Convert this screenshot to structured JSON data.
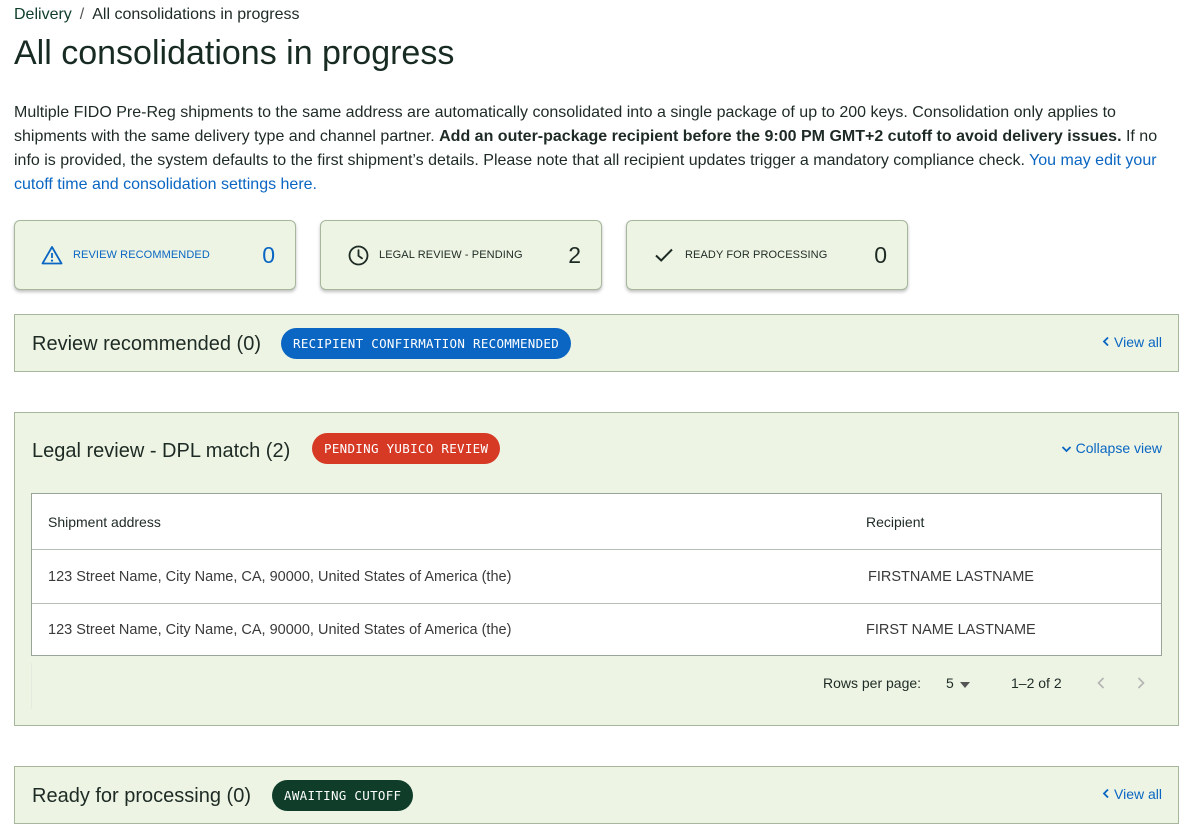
{
  "breadcrumb": {
    "parent": "Delivery",
    "separator": "/",
    "current": "All consolidations in progress"
  },
  "page_title": "All consolidations in progress",
  "intro": {
    "text1": "Multiple FIDO Pre-Reg shipments to the same address are automatically consolidated into a single package of up to 200 keys. Consolidation only applies to shipments with the same delivery type and channel partner. ",
    "bold": "Add an outer-package recipient before the 9:00 PM GMT+2 cutoff to avoid delivery issues.",
    "text2": " If no info is provided, the system defaults to the first shipment’s details. Please note that all recipient updates trigger a mandatory compliance check. ",
    "link": "You may edit your cutoff time and consolidation settings here."
  },
  "status_cards": {
    "review": {
      "icon": "warning-triangle-icon",
      "label": "REVIEW RECOMMENDED",
      "count": "0"
    },
    "legal": {
      "icon": "clock-icon",
      "label": "LEGAL REVIEW - PENDING",
      "count": "2"
    },
    "ready": {
      "icon": "checkmark-icon",
      "label": "READY FOR PROCESSING",
      "count": "0"
    }
  },
  "sections": {
    "review": {
      "title": "Review recommended (0)",
      "pill": "RECIPIENT CONFIRMATION RECOMMENDED",
      "action": "View all"
    },
    "legal": {
      "title": "Legal review - DPL match (2)",
      "pill": "PENDING YUBICO REVIEW",
      "action": "Collapse view"
    },
    "ready": {
      "title": "Ready for processing (0)",
      "pill": "AWAITING CUTOFF",
      "action": "View all"
    }
  },
  "table": {
    "headers": [
      "Shipment address",
      "Recipient"
    ],
    "rows": [
      [
        "123 Street Name, City Name, CA, 90000, United States of America (the)",
        "FIRSTNAME LASTNAME"
      ],
      [
        "123 Street Name, City Name, CA, 90000, United States of America (the)",
        "FIRST NAME LASTNAME"
      ]
    ]
  },
  "pagination": {
    "rows_per_page_label": "Rows per page:",
    "rows_per_page_value": "5",
    "range": "1–2 of 2"
  },
  "colors": {
    "accent_blue": "#0a66c2",
    "danger_red": "#d63a25",
    "dark_green": "#0f3d2a",
    "panel_bg": "#edf4e4",
    "panel_border": "#a6b79c"
  }
}
